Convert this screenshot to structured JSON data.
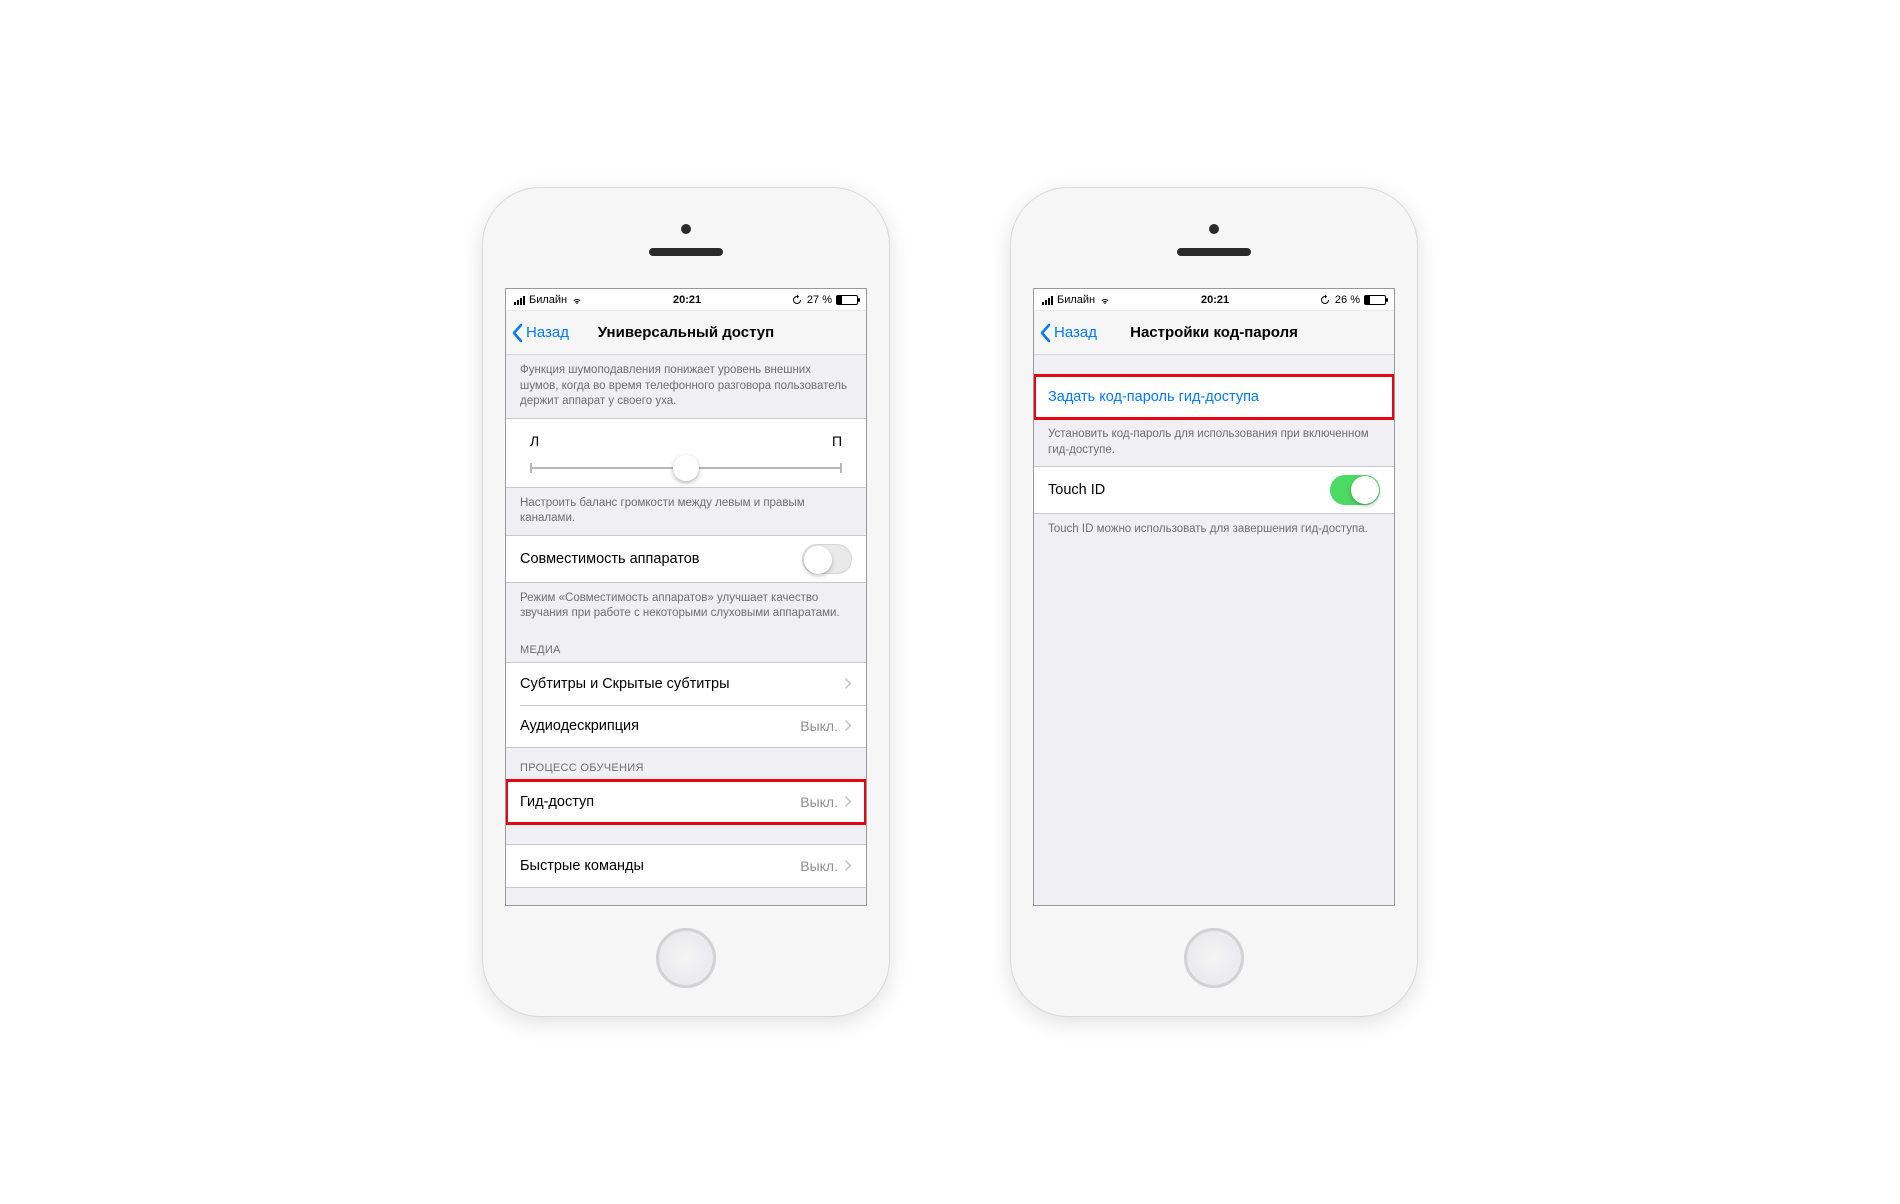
{
  "phone1": {
    "status": {
      "carrier": "Билайн",
      "time": "20:21",
      "battery_text": "27 %",
      "battery_fill_pct": 27
    },
    "nav": {
      "back": "Назад",
      "title": "Универсальный доступ"
    },
    "noise_desc": "Функция шумоподавления понижает уровень внешних шумов, когда во время телефонного разговора пользователь держит аппарат у своего уха.",
    "balance": {
      "left": "Л",
      "right": "П"
    },
    "balance_desc": "Настроить баланс громкости между левым и правым каналами.",
    "hearing_aid_label": "Совместимость аппаратов",
    "hearing_aid_desc": "Режим «Совместимость аппаратов» улучшает качество звучания при работе с некоторыми слуховыми аппаратами.",
    "section_media": "МЕДИА",
    "subtitles_label": "Субтитры и Скрытые субтитры",
    "audiodesc_label": "Аудиодескрипция",
    "audiodesc_value": "Выкл.",
    "section_learning": "ПРОЦЕСС ОБУЧЕНИЯ",
    "guided_label": "Гид-доступ",
    "guided_value": "Выкл.",
    "shortcuts_label": "Быстрые команды",
    "shortcuts_value": "Выкл."
  },
  "phone2": {
    "status": {
      "carrier": "Билайн",
      "time": "20:21",
      "battery_text": "26 %",
      "battery_fill_pct": 26
    },
    "nav": {
      "back": "Назад",
      "title": "Настройки код-пароля"
    },
    "set_passcode_label": "Задать код-пароль гид-доступа",
    "set_passcode_desc": "Установить код-пароль для использования при включенном гид-доступе.",
    "touchid_label": "Touch ID",
    "touchid_desc": "Touch ID можно использовать для завершения гид-доступа."
  }
}
